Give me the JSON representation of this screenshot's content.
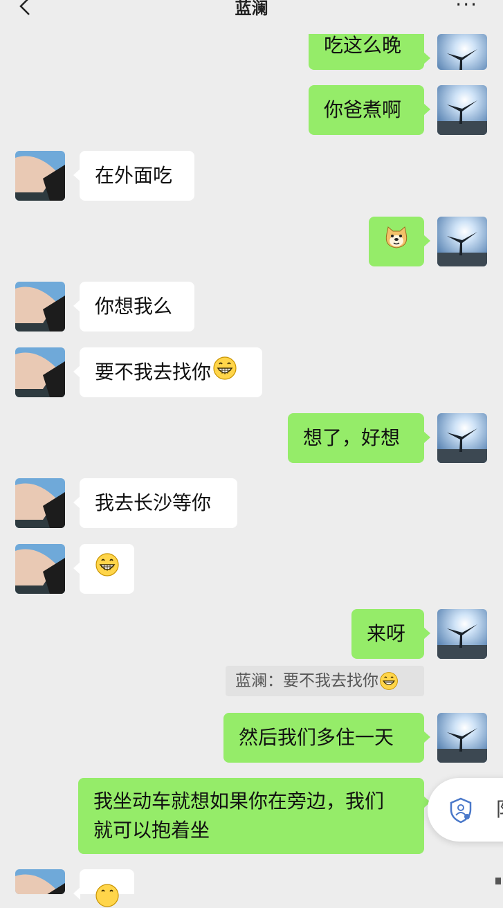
{
  "header": {
    "title": "蓝澜",
    "back_icon": "chevron-left-icon",
    "more_icon": "more-icon",
    "more_label": "···"
  },
  "messages": [
    {
      "side": "me",
      "text": "吃这么晚"
    },
    {
      "side": "me",
      "text": "你爸煮啊"
    },
    {
      "side": "them",
      "text": "在外面吃"
    },
    {
      "side": "me",
      "text": "",
      "sticker": "doge-emoji"
    },
    {
      "side": "them",
      "text": "你想我么"
    },
    {
      "side": "them",
      "text": "要不我去找你",
      "emoji": "grin-emoji"
    },
    {
      "side": "me",
      "text": "想了，好想"
    },
    {
      "side": "them",
      "text": "我去长沙等你"
    },
    {
      "side": "them",
      "text": "",
      "emoji": "grin-emoji"
    },
    {
      "side": "me",
      "text": "来呀"
    },
    {
      "side": "me",
      "text": "然后我们多住一天"
    },
    {
      "side": "me",
      "text_line1": "我坐动车就想如果你在旁边，我们",
      "text_line2": "就可以抱着坐"
    },
    {
      "side": "them",
      "text": "",
      "emoji": "grin-emoji"
    }
  ],
  "quote": {
    "text": "蓝澜：要不我去找你",
    "emoji": "grin-emoji"
  },
  "floating_button": {
    "icon": "shield-user-icon",
    "label": "阝"
  },
  "colors": {
    "my_bubble": "#95ec69",
    "their_bubble": "#ffffff",
    "background": "#ededed"
  }
}
